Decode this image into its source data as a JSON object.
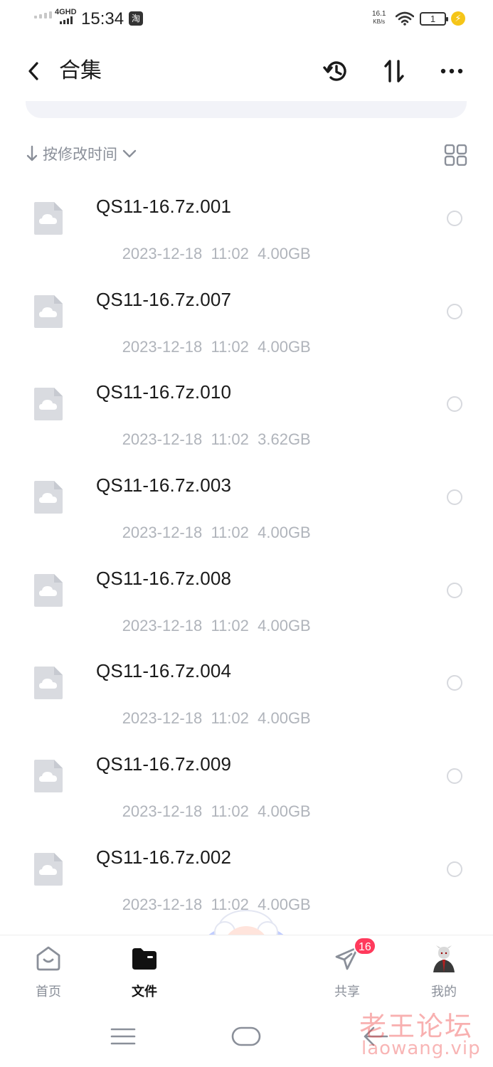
{
  "status_bar": {
    "network": "4GHD",
    "time": "15:34",
    "app_icon": "淘",
    "speed_value": "16.1",
    "speed_unit": "KB/s",
    "battery": "1"
  },
  "header": {
    "back_icon": "chevron-left-icon",
    "title": "合集",
    "actions": [
      "history-icon",
      "sort-arrows-icon",
      "more-dots-icon"
    ]
  },
  "sort_bar": {
    "label": "按修改时间",
    "view_toggle_icon": "grid-view-icon"
  },
  "files": [
    {
      "name": "QS11-16.7z.001",
      "date": "2023-12-18",
      "time": "11:02",
      "size": "4.00GB"
    },
    {
      "name": "QS11-16.7z.007",
      "date": "2023-12-18",
      "time": "11:02",
      "size": "4.00GB"
    },
    {
      "name": "QS11-16.7z.010",
      "date": "2023-12-18",
      "time": "11:02",
      "size": "3.62GB"
    },
    {
      "name": "QS11-16.7z.003",
      "date": "2023-12-18",
      "time": "11:02",
      "size": "4.00GB"
    },
    {
      "name": "QS11-16.7z.008",
      "date": "2023-12-18",
      "time": "11:02",
      "size": "4.00GB"
    },
    {
      "name": "QS11-16.7z.004",
      "date": "2023-12-18",
      "time": "11:02",
      "size": "4.00GB"
    },
    {
      "name": "QS11-16.7z.009",
      "date": "2023-12-18",
      "time": "11:02",
      "size": "4.00GB"
    },
    {
      "name": "QS11-16.7z.002",
      "date": "2023-12-18",
      "time": "11:02",
      "size": "4.00GB"
    }
  ],
  "bottom_nav": {
    "items": [
      {
        "label": "首页",
        "icon": "home-icon"
      },
      {
        "label": "文件",
        "icon": "folder-icon",
        "active": true
      },
      {
        "label": "共享",
        "icon": "send-icon",
        "badge": "16"
      },
      {
        "label": "我的",
        "icon": "avatar"
      }
    ]
  },
  "watermark": {
    "cn": "老王论坛",
    "en": "laowang.vip"
  },
  "colors": {
    "accent": "#1a1a1a",
    "muted": "#8a8f99",
    "meta": "#b0b4bb",
    "badge": "#ff3a5c"
  }
}
